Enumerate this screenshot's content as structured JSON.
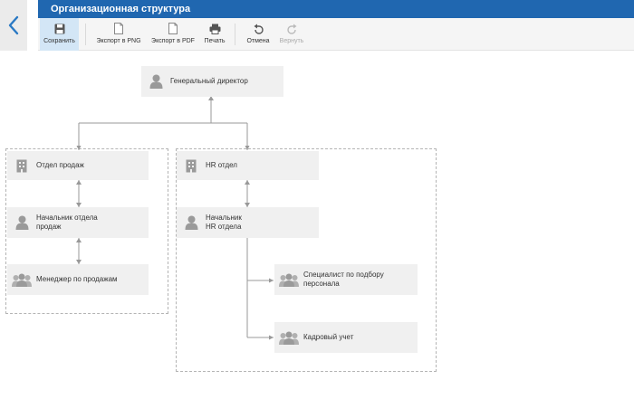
{
  "title": "Организационная структура",
  "toolbar": {
    "save": "Сохранить",
    "export_png": "Экспорт в PNG",
    "export_pdf": "Экспорт в PDF",
    "print": "Печать",
    "undo": "Отмена",
    "redo": "Вернуть"
  },
  "nodes": {
    "ceo": "Генеральный директор",
    "sales_dept": "Отдел продаж",
    "sales_head_1": "Начальник отдела",
    "sales_head_2": "продаж",
    "sales_manager": "Менеджер по продажам",
    "hr_dept": "HR отдел",
    "hr_head_1": "Начальник",
    "hr_head_2": "HR отдела",
    "recruiter_1": "Специалист по подбору",
    "recruiter_2": "персонала",
    "personnel": "Кадровый учет"
  },
  "colors": {
    "title_bar": "#2067b0",
    "back_arrow": "#2a79c4",
    "active_button": "#d3e6f6",
    "node_bg": "#f0f0f0",
    "icon": "#9a9a9a"
  }
}
